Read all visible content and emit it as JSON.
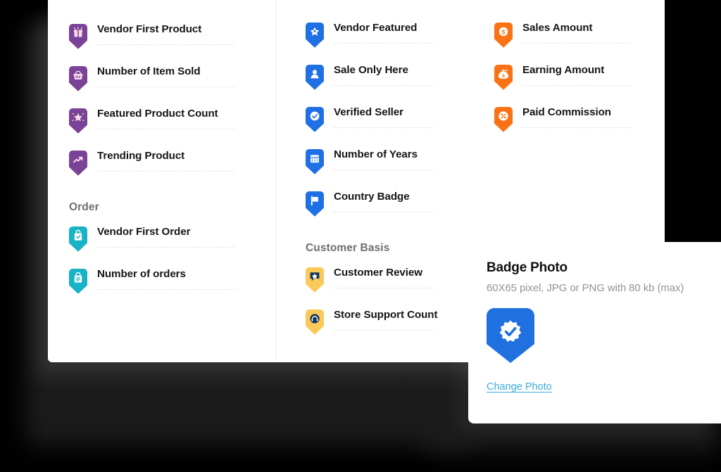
{
  "theme": {
    "page_background": "#000000",
    "card_background": "#ffffff",
    "purple": "#7B4397",
    "teal": "#18B3C4",
    "blue": "#1F6FE5",
    "yellow": "#FBC85A",
    "navy": "#12335B",
    "orange": "#F97316",
    "label_color": "#161618",
    "section_color": "#6E6E73",
    "rule_color": "#E4E4E4",
    "link_color": "#3BABDE"
  },
  "columns": [
    {
      "name": "product-column",
      "sections": [
        {
          "heading": null,
          "items": [
            {
              "label": "Vendor First Product",
              "icon": "gift-badge-icon",
              "color": "#7B4397"
            },
            {
              "label": "Number of Item Sold",
              "icon": "basket-badge-icon",
              "color": "#7B4397"
            },
            {
              "label": "Featured Product Count",
              "icon": "sparkle-star-badge-icon",
              "color": "#7B4397"
            },
            {
              "label": "Trending Product",
              "icon": "trend-arrow-badge-icon",
              "color": "#7B4397"
            }
          ]
        },
        {
          "heading": "Order",
          "items": [
            {
              "label": "Vendor First Order",
              "icon": "shopping-bag-check-badge-icon",
              "color": "#18B3C4"
            },
            {
              "label": "Number of orders",
              "icon": "shopping-bag-list-badge-icon",
              "color": "#18B3C4"
            }
          ]
        }
      ]
    },
    {
      "name": "vendor-column",
      "sections": [
        {
          "heading": null,
          "items": [
            {
              "label": "Vendor Featured",
              "icon": "star-badge-icon",
              "color": "#1F6FE5"
            },
            {
              "label": "Sale Only Here",
              "icon": "person-badge-icon",
              "color": "#1F6FE5"
            },
            {
              "label": "Verified Seller",
              "icon": "verified-badge-icon",
              "color": "#1F6FE5"
            },
            {
              "label": "Number of Years",
              "icon": "calendar-badge-icon",
              "color": "#1F6FE5"
            },
            {
              "label": "Country Badge",
              "icon": "flag-badge-icon",
              "color": "#1F6FE5"
            }
          ]
        },
        {
          "heading": "Customer Basis",
          "items": [
            {
              "label": "Customer Review",
              "icon": "review-star-badge-icon",
              "color": "#FBC85A"
            },
            {
              "label": "Store Support Count",
              "icon": "headset-badge-icon",
              "color": "#FBC85A"
            }
          ]
        }
      ]
    },
    {
      "name": "earnings-column",
      "sections": [
        {
          "heading": null,
          "items": [
            {
              "label": "Sales Amount",
              "icon": "dollar-coin-badge-icon",
              "color": "#F97316"
            },
            {
              "label": "Earning Amount",
              "icon": "money-bag-badge-icon",
              "color": "#F97316"
            },
            {
              "label": "Paid Commission",
              "icon": "percent-badge-icon",
              "color": "#F97316"
            }
          ]
        }
      ]
    }
  ],
  "photo_panel": {
    "title": "Badge Photo",
    "subtitle": "60X65 pixel, JPG or PNG with 80 kb (max)",
    "preview_icon": "verified-check-badge-icon",
    "preview_color": "#2070E0",
    "change_link": "Change Photo"
  }
}
